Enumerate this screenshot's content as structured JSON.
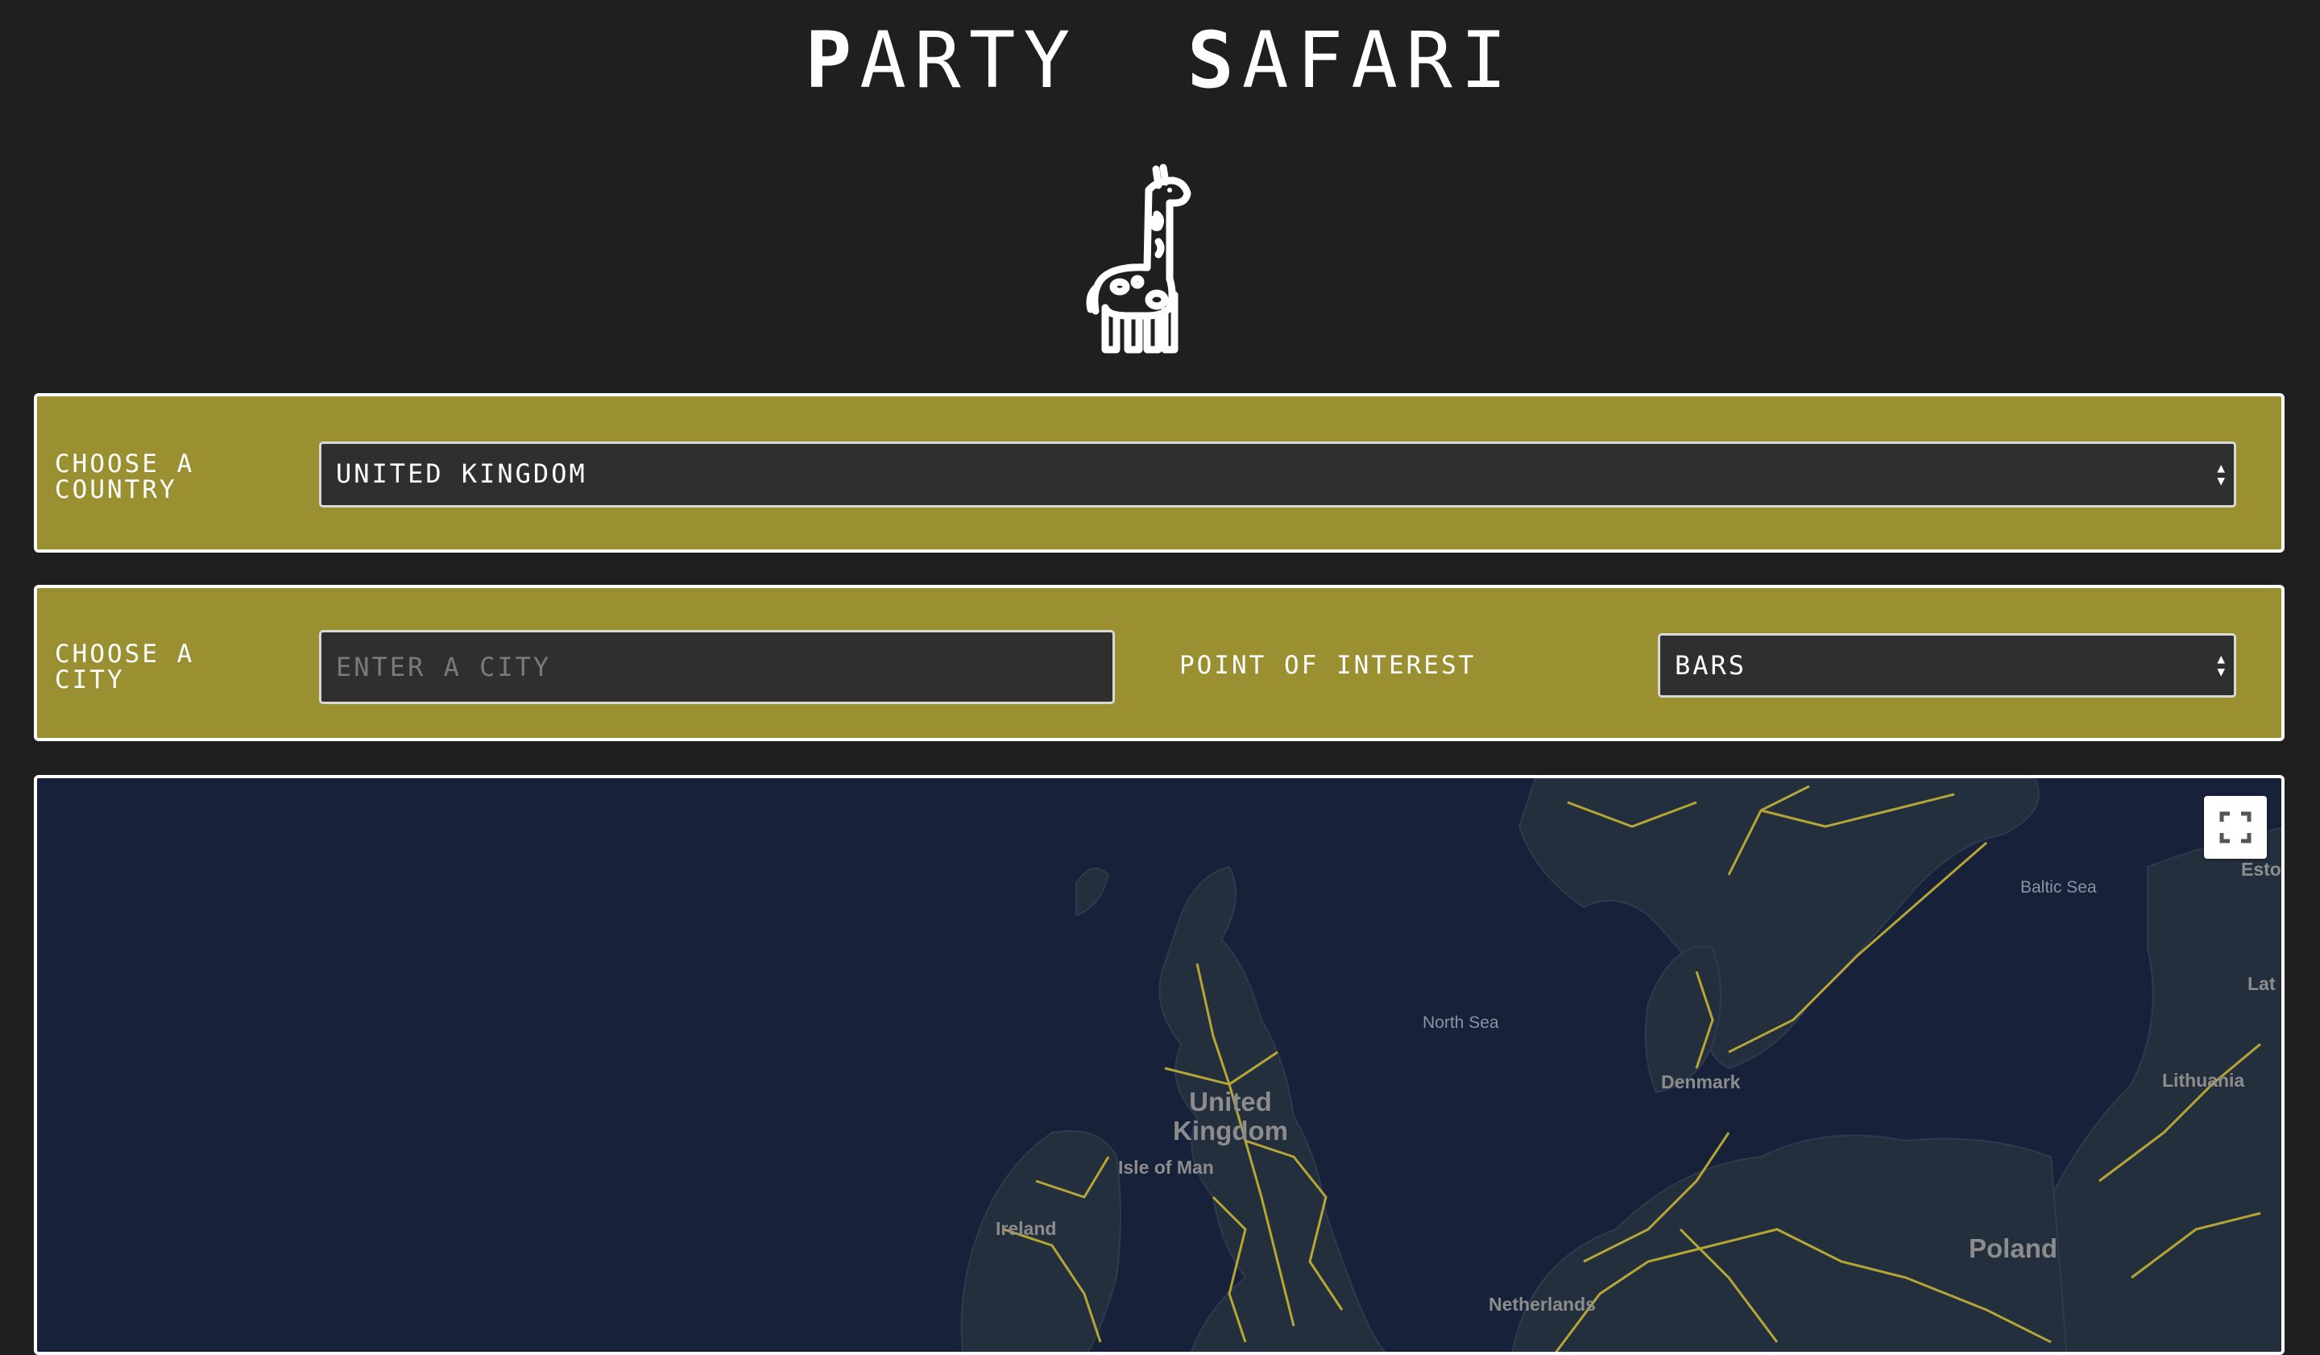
{
  "header": {
    "title_cap1": "P",
    "title_rest1": "ARTY",
    "title_cap2": "S",
    "title_rest2": "AFARI",
    "logo_icon": "giraffe-icon"
  },
  "country_panel": {
    "label_line1": "Choose a",
    "label_line2": "Country",
    "selected_country": "United Kingdom"
  },
  "city_panel": {
    "label_line1": "Choose a",
    "label_line2": "City",
    "city_placeholder": "Enter a City",
    "poi_label": "Point of Interest",
    "poi_selected": "Bars"
  },
  "map": {
    "labels": {
      "north_sea": "North Sea",
      "baltic_sea": "Baltic Sea",
      "united": "United",
      "kingdom": "Kingdom",
      "isle_of_man": "Isle of Man",
      "ireland": "Ireland",
      "denmark": "Denmark",
      "lithuania": "Lithuania",
      "poland": "Poland",
      "netherlands": "Netherlands",
      "esto": "Esto",
      "lat": "Lat"
    },
    "fullscreen_icon": "fullscreen-icon",
    "colors": {
      "water": "#17223a",
      "land": "#242f3e",
      "roads": "#c5b335"
    }
  },
  "colors": {
    "background": "#1f1f1f",
    "panel": "#9a8f31",
    "field": "#2f2f2f"
  }
}
